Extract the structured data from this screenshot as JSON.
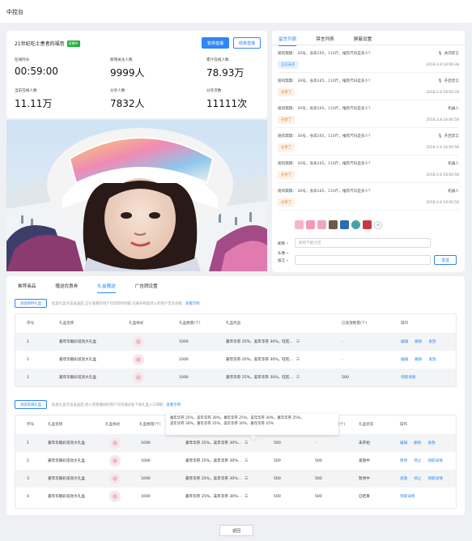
{
  "page_title": "中控台",
  "live": {
    "title": "21世纪吃土患者的福音",
    "badge": "直播中",
    "pause_btn": "暂停直播",
    "end_btn": "结束直播",
    "stats": [
      {
        "label": "在线时长",
        "value": "00:59:00"
      },
      {
        "label": "新增关注人数",
        "value": "9999人"
      },
      {
        "label": "累计在线人数",
        "value": "78.93万"
      },
      {
        "label": "当前在线人数",
        "value": "11.11万"
      },
      {
        "label": "分享人数",
        "value": "7832人"
      },
      {
        "label": "分享次数",
        "value": "11111次"
      }
    ]
  },
  "chat": {
    "tabs": [
      "留言列表",
      "禁言列表",
      "屏蔽设置"
    ],
    "active_tab": 0,
    "messages": [
      {
        "text": "随风飘飘： 30号，身高165，110斤，推荐尺码是多少？",
        "right": "关闭禁言",
        "right_icon": "mic-icon",
        "tag": "正在去买",
        "tag_style": "blue",
        "time": "2018.3.8 18:00:38"
      },
      {
        "text": "随风飘飘： 30号，身高165，110斤，推荐尺码是多少？",
        "right": "开启禁言",
        "right_icon": "mic-icon",
        "tag": "分享了",
        "tag_style": "orange",
        "time": "2018.3.8 18:00:28"
      },
      {
        "text": "随风飘飘： 30号，身高165，110斤，推荐尺码是多少？",
        "right": "机器人",
        "right_icon": "",
        "tag": "分享了",
        "tag_style": "orange",
        "time": "2018.3.8 18:00:58"
      },
      {
        "text": "随风飘飘： 30号，身高165，110斤，推荐尺码是多少？",
        "right": "开启禁言",
        "right_icon": "mic-icon",
        "tag": "分享了",
        "tag_style": "orange",
        "time": "2018.3.8 18:00:58"
      },
      {
        "text": "随风飘飘： 30号，身高165，110斤，推荐尺码是多少？",
        "right": "机器人",
        "right_icon": "",
        "tag": "分享了",
        "tag_style": "orange",
        "time": "2018.3.8 18:00:58"
      },
      {
        "text": "随风飘飘： 30号，身高165，110斤，推荐尺码是多少？",
        "right": "机器人",
        "right_icon": "",
        "tag": "分享了",
        "tag_style": "orange",
        "time": "2018.3.8 18:00:58"
      }
    ],
    "avatar_label": "头像",
    "nickname_label": "昵称",
    "nickname_placeholder": "昵称不能为空",
    "comment_label": "留言",
    "send_btn": "发送"
  },
  "bottom": {
    "tabs": [
      "推荐商品",
      "赠送优惠券",
      "礼盒赠送",
      "广告牌设置"
    ],
    "active_tab": 2,
    "instant": {
      "add_btn": "添加即时礼盒",
      "hint": "此类礼盒点击发送后,正在观看的用户均可即时领取,已离开和后进入的用户无法领取",
      "hint_link": "查看示例",
      "headers": [
        "序号",
        "礼盒名称",
        "礼盒样式",
        "礼盒数量(个)",
        "礼盒奖品",
        "已发放数量(个)",
        "操作"
      ],
      "rows": [
        {
          "no": "1",
          "name": "嘉年华靓彩炫亮大礼盒",
          "qty": "1000",
          "prize": "嘉年华券 25%，美年华券 30%，旺旺...",
          "sent": "-",
          "ops": [
            "编辑",
            "删除",
            "发放"
          ]
        },
        {
          "no": "1",
          "name": "嘉年华靓彩炫亮大礼盒",
          "qty": "1000",
          "prize": "嘉年华券 25%，美年华券 30%，旺旺...",
          "sent": "-",
          "ops": [
            "编辑",
            "删除",
            "发放"
          ]
        },
        {
          "no": "1",
          "name": "嘉年华靓彩炫亮大礼盒",
          "qty": "1000",
          "prize": "嘉年华券 25%，美年华券 30%，旺旺...",
          "sent": "500",
          "ops": [
            "领取详情"
          ]
        }
      ]
    },
    "regular": {
      "add_btn": "添加常规礼盒",
      "hint": "此类礼盒点击发送后,进入到直播间的用户均可通过右下角礼盒入口领取",
      "hint_link": "查看示例",
      "headers": [
        "序号",
        "礼盒名称",
        "礼盒样式",
        "礼盒数量(个)",
        "礼盒奖品",
        "",
        "(个)",
        "礼盒状态",
        "操作"
      ],
      "rows": [
        {
          "no": "1",
          "name": "嘉年华靓彩炫亮大礼盒",
          "qty": "1000",
          "prize": "嘉年华券 25%，美年华券 30%...",
          "c1": "500",
          "c2": "-",
          "status": "未开始",
          "ops": [
            "编辑",
            "删除",
            "发放"
          ]
        },
        {
          "no": "2",
          "name": "嘉年华靓彩炫亮大礼盒",
          "qty": "1000",
          "prize": "嘉年华券 25%，美年华券 30%...",
          "c1": "500",
          "c2": "500",
          "status": "发放中",
          "ops": [
            "暂停",
            "停止",
            "领取详情"
          ]
        },
        {
          "no": "3",
          "name": "嘉年华靓彩炫亮大礼盒",
          "qty": "1000",
          "prize": "嘉年华券 25%，美年华券 30%...",
          "c1": "500",
          "c2": "500",
          "status": "暂停中",
          "ops": [
            "发放",
            "停止",
            "领取详情"
          ]
        },
        {
          "no": "4",
          "name": "嘉年华靓彩炫亮大礼盒",
          "qty": "1000",
          "prize": "嘉年华券 25%，美年华券 30%...",
          "c1": "500",
          "c2": "500",
          "status": "已结束",
          "ops": [
            "领取详情"
          ]
        }
      ],
      "tooltip_lines": [
        "嘉年华券 25%，美年华券 30%，嘉年华券 25%，美年华券 30%，嘉年华券 25%，",
        "美年华券 30%，嘉年华券 25%，美年华券 30%，嘉年华券 25%"
      ]
    }
  },
  "back_btn": "返回",
  "colors": {
    "accent": "#2f86f6",
    "live_badge": "#23b13b",
    "share_tag": "#e07c1e"
  }
}
